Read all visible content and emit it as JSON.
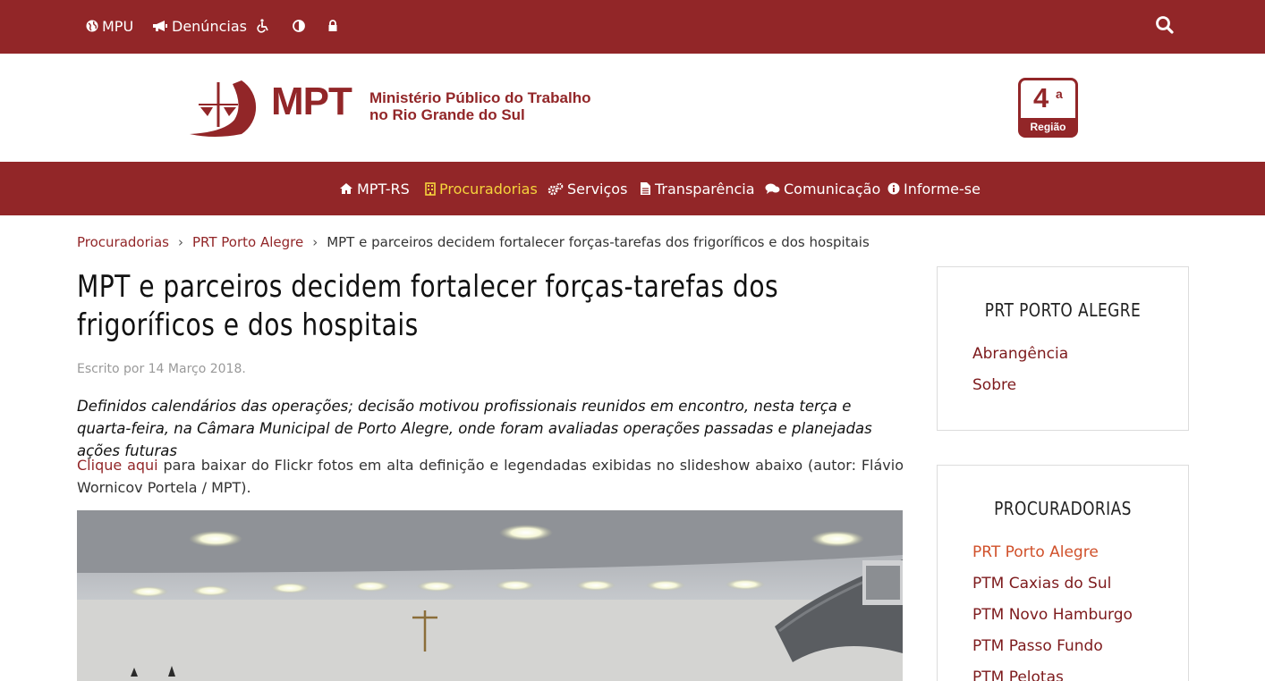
{
  "topbar": {
    "mpu_label": "MPU",
    "denuncias_label": "Denúncias",
    "icons": [
      "globe-icon",
      "bullhorn-icon",
      "wheelchair-icon",
      "contrast-icon",
      "lock-icon",
      "search-icon"
    ]
  },
  "header": {
    "logo_abbr": "MPT",
    "logo_line1": "Ministério Público do Trabalho",
    "logo_line2": "no Rio Grande do Sul",
    "region_number": "4",
    "region_sup": "a",
    "region_label": "Região"
  },
  "nav": {
    "items": [
      {
        "label": "MPT-RS",
        "icon": "home-icon"
      },
      {
        "label": "Procuradorias",
        "icon": "building-icon",
        "active": true
      },
      {
        "label": "Serviços",
        "icon": "cogs-icon"
      },
      {
        "label": "Transparência",
        "icon": "document-icon"
      },
      {
        "label": "Comunicação",
        "icon": "comments-icon"
      },
      {
        "label": "Informe-se",
        "icon": "info-icon"
      }
    ]
  },
  "breadcrumb": {
    "items": [
      "Procuradorias",
      "PRT Porto Alegre"
    ],
    "current": "MPT e parceiros decidem fortalecer forças-tarefas dos frigoríficos e dos hospitais"
  },
  "article": {
    "title": "MPT e parceiros decidem fortalecer forças-tarefas dos frigoríficos e dos hospitais",
    "meta": "Escrito por 14 Março 2018.",
    "lead": "Definidos calendários das operações; decisão motivou profissionais reunidos em encontro, nesta terça e quarta-feira, na Câmara Municipal de Porto Alegre, onde foram avaliadas operações passadas e planejadas ações futuras",
    "link_text": "Clique aqui",
    "paragraph_rest": " para baixar do Flickr fotos em alta definição e legendadas exibidas no slideshow abaixo (autor: Flávio Wornicov Portela / MPT)."
  },
  "sidebar": {
    "card1": {
      "title": "PRT PORTO ALEGRE",
      "links": [
        "Abrangência",
        "Sobre"
      ]
    },
    "card2": {
      "title": "PROCURADORIAS",
      "links": [
        "PRT Porto Alegre",
        "PTM Caxias do Sul",
        "PTM Novo Hamburgo",
        "PTM Passo Fundo",
        "PTM Pelotas"
      ]
    }
  },
  "colors": {
    "brand": "#922628",
    "nav_active": "#f5d33c",
    "sidebar_active": "#d0502a"
  }
}
